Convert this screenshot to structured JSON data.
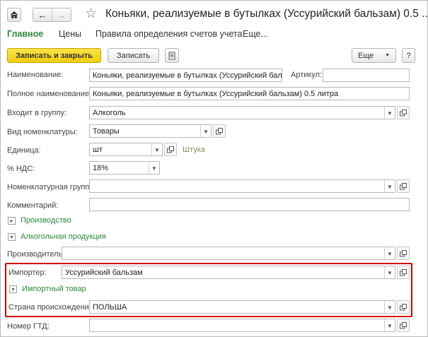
{
  "window": {
    "title": "Коньяки, реализуемые в бутылках (Уссурийский бальзам) 0.5 ..."
  },
  "nav": {
    "home_icon": "home-icon",
    "back_icon": "arrow-left-icon",
    "forward_icon": "arrow-right-icon",
    "favorite_icon": "star-icon"
  },
  "menu": {
    "main": "Главное",
    "prices": "Цены",
    "rules": "Правила определения счетов учета",
    "more": "Еще..."
  },
  "toolbar": {
    "save_close": "Записать и закрыть",
    "save": "Записать",
    "more": "Еще",
    "help": "?"
  },
  "form": {
    "name_label": "Наименование:",
    "name_value": "Коньяки, реализуемые в бутылках (Уссурийский бальзам)",
    "article_label": "Артикул:",
    "article_value": "",
    "full_name_label": "Полное наименование:",
    "full_name_value": "Коньяки, реализуемые в бутылках (Уссурийский бальзам) 0.5 литра",
    "group_label": "Входит в группу:",
    "group_value": "Алкоголь",
    "kind_label": "Вид номенклатуры:",
    "kind_value": "Товары",
    "unit_label": "Единица:",
    "unit_value": "шт",
    "unit_hint": "Штука",
    "vat_label": "% НДС:",
    "vat_value": "18%",
    "nom_group_label": "Номенклатурная группа:",
    "nom_group_value": "",
    "comment_label": "Комментарий:",
    "comment_value": "",
    "section_production": "Производство",
    "section_alcohol": "Алкогольная продукция",
    "producer_label": "Производитель:",
    "producer_value": "",
    "importer_label": "Импортер:",
    "importer_value": "Уссурийский бальзам",
    "section_imported": "Импортный товар",
    "country_label": "Страна происхождения:",
    "country_value": "ПОЛЬША",
    "gtd_label": "Номер ГТД:",
    "gtd_value": ""
  },
  "colors": {
    "accent_green": "#2b8a3e",
    "primary_yellow": "#f2cd10",
    "highlight_red": "#d10000"
  }
}
